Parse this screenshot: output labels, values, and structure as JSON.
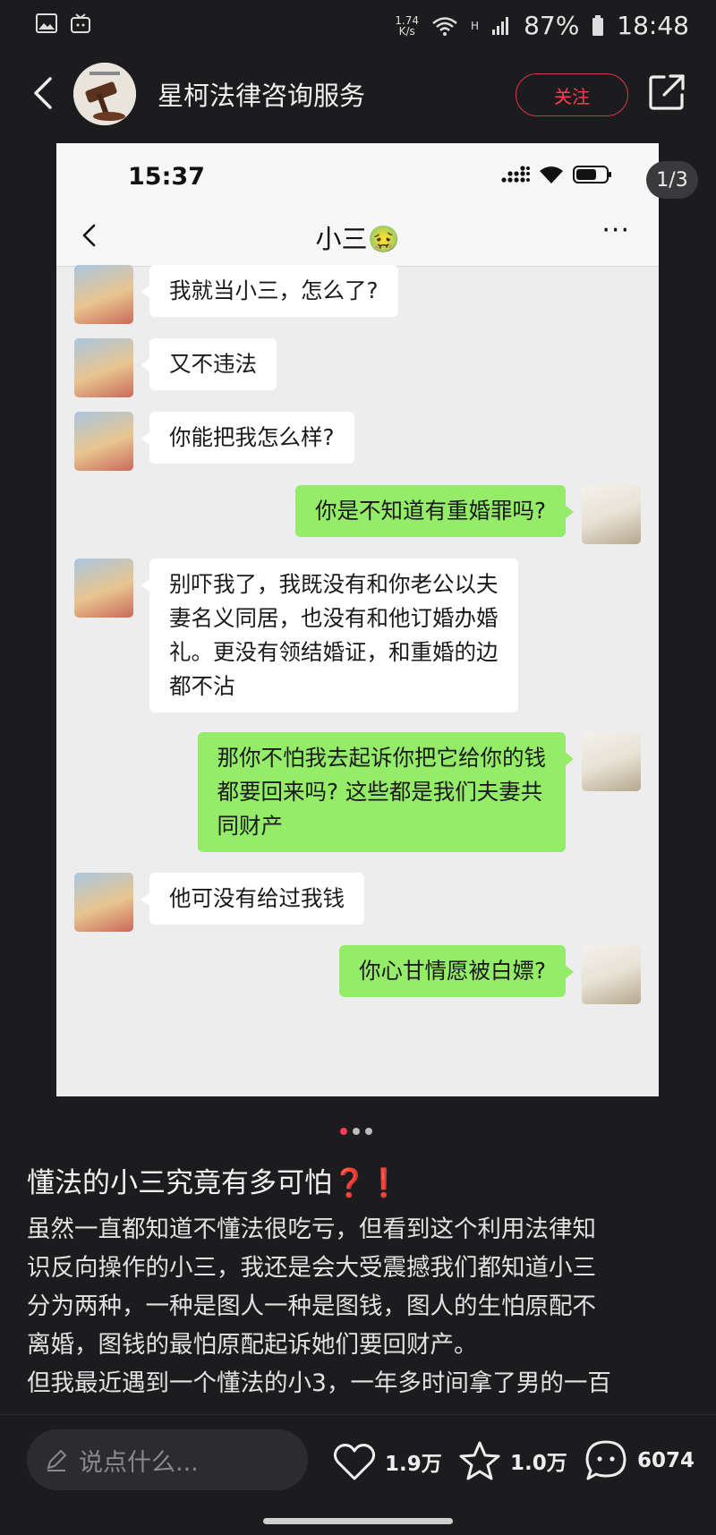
{
  "status_bar": {
    "net_speed_value": "1.74",
    "net_speed_unit": "K/s",
    "signal_label": "H",
    "battery": "87%",
    "time": "18:48"
  },
  "header": {
    "title": "星柯法律咨询服务",
    "follow_label": "关注"
  },
  "image_counter": "1/3",
  "screenshot": {
    "phone_time": "15:37",
    "chat_title": "小三🤢",
    "more": "···",
    "messages": [
      {
        "side": "in",
        "lines": [
          "我就当小三，怎么了?"
        ]
      },
      {
        "side": "in",
        "lines": [
          "又不违法"
        ]
      },
      {
        "side": "in",
        "lines": [
          "你能把我怎么样?"
        ]
      },
      {
        "side": "out",
        "lines": [
          "你是不知道有重婚罪吗?"
        ]
      },
      {
        "side": "in",
        "lines": [
          "别吓我了，我既没有和你老公以夫",
          "妻名义同居，也没有和他订婚办婚",
          "礼。更没有领结婚证，和重婚的边",
          "都不沾"
        ]
      },
      {
        "side": "out",
        "lines": [
          "那你不怕我去起诉你把它给你的钱",
          "都要回来吗? 这些都是我们夫妻共",
          "同财产"
        ]
      },
      {
        "side": "in",
        "lines": [
          "他可没有给过我钱"
        ]
      },
      {
        "side": "out",
        "lines": [
          "你心甘情愿被白嫖?"
        ]
      }
    ]
  },
  "post": {
    "title": "懂法的小三究竟有多可怕❓❗",
    "body_lines": [
      "虽然一直都知道不懂法很吃亏，但看到这个利用法律知",
      "识反向操作的小三，我还是会大受震撼我们都知道小三",
      "分为两种，一种是图人一种是图钱，图人的生怕原配不",
      "离婚，图钱的最怕原配起诉她们要回财产。",
      "但我最近遇到一个懂法的小3，一年多时间拿了男的一百"
    ]
  },
  "bottom_bar": {
    "comment_placeholder": "说点什么...",
    "likes": "1.9万",
    "favorites": "1.0万",
    "comments": "6074"
  },
  "colors": {
    "background": "#1c1c1e",
    "accent_red": "#ff3b55",
    "bubble_out": "#95ec69",
    "bubble_in": "#ffffff"
  },
  "icons": [
    "gallery-icon",
    "tv-icon",
    "wifi-icon",
    "signal-icon",
    "battery-icon",
    "back-icon",
    "share-icon",
    "edit-icon",
    "heart-icon",
    "star-icon",
    "comment-icon"
  ]
}
